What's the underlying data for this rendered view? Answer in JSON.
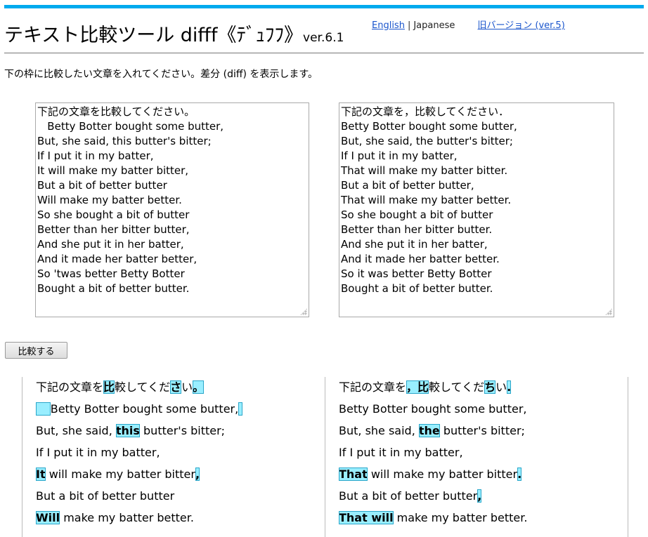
{
  "header": {
    "title_main": "テキスト比較ツール difff《ﾃﾞｭﾌﾌ》",
    "title_version": "ver.6.1",
    "lang_english": "English",
    "lang_separator": "|",
    "lang_japanese": "Japanese",
    "old_version_link": "旧バージョン (ver.5)"
  },
  "intro_text": "下の枠に比較したい文章を入れてください。差分 (diff) を表示します。",
  "input": {
    "left_text": "下記の文章を比較してください。\n   Betty Botter bought some butter,\nBut, she said, this butter's bitter;\nIf I put it in my batter,\nIt will make my batter bitter,\nBut a bit of better butter\nWill make my batter better.\nSo she bought a bit of butter\nBetter than her bitter butter,\nAnd she put it in her batter,\nAnd it made her batter better,\nSo 'twas better Betty Botter\nBought a bit of better butter.",
    "right_text": "下記の文章を，比較してください．\nBetty Botter bought some butter,\nBut, she said, the butter's bitter;\nIf I put it in my batter,\nThat will make my batter bitter.\nBut a bit of better butter,\nThat will make my batter better.\nSo she bought a bit of butter\nBetter than her bitter butter.\nAnd she put it in her batter,\nAnd it made her batter better.\nSo it was better Betty Botter\nBought a bit of better butter."
  },
  "compare_button": "比較する",
  "diff": {
    "left": {
      "l1": {
        "a": "下記の文章を",
        "b": "比",
        "c": "較してくだ",
        "d": "さ",
        "e": "い",
        "f": "。"
      },
      "l2": {
        "b": "Betty Botter bought some butter,"
      },
      "l3": {
        "a": "But, she said, ",
        "b": "this",
        "c": " butter's bitter;"
      },
      "l4": {
        "a": "If I put it in my batter,"
      },
      "l5": {
        "a": "It",
        "b": " will make my batter bitter",
        "c": ","
      },
      "l6": {
        "a": "But a bit of better butter"
      },
      "l7": {
        "a": "Will",
        "b": " make my batter better."
      }
    },
    "right": {
      "l1": {
        "a": "下記の文章を",
        "b": "，比",
        "c": "較してくだ",
        "d": "ち",
        "e": "い",
        "f": "."
      },
      "l2": {
        "a": "Betty Botter bought some butter,"
      },
      "l3": {
        "a": "But, she said, ",
        "b": "the",
        "c": " butter's bitter;"
      },
      "l4": {
        "a": "If I put it in my batter,"
      },
      "l5": {
        "a": "That",
        "b": " will make my batter bitter",
        "c": "."
      },
      "l6": {
        "a": "But a bit of better butter",
        "b": ","
      },
      "l7": {
        "a": "That will",
        "b": " make my batter better."
      }
    }
  }
}
